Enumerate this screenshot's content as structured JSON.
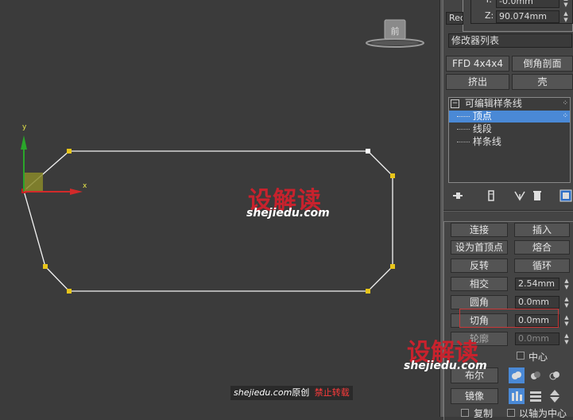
{
  "viewport": {
    "axes": {
      "x_label": "x",
      "y_label": "y"
    },
    "watermark": {
      "brand": "设解读",
      "url": "shejiedu.com"
    },
    "credit": {
      "site": "shejiedu.com",
      "original": "原创",
      "warning": "禁止转载"
    },
    "colors": {
      "background": "#3b3b3b",
      "spline": "#f4f4f4",
      "vertex": "#e8c51a",
      "selected_vertex": "#ffffff",
      "axis_x": "#d22a2a",
      "axis_y": "#2aa62a",
      "watermark_red": "#c8222d"
    }
  },
  "panel": {
    "top_coords": {
      "y_label": "Y:",
      "y_value": "-0.0mm",
      "z_label": "Z:",
      "z_value": "90.074mm"
    },
    "object_name": "Rec",
    "modifier_list": "修改器列表",
    "buttons_row1": [
      "FFD 4x4x4",
      "倒角剖面"
    ],
    "buttons_row2": [
      "挤出",
      "壳"
    ],
    "stack": {
      "root": "可编辑样条线",
      "items": [
        "顶点",
        "线段",
        "样条线"
      ]
    },
    "geometry": {
      "connect": "连接",
      "insert": "插入",
      "make_first": "设为首顶点",
      "fuse": "熔合",
      "reverse": "反转",
      "cycle": "循环",
      "cross_insert": "相交",
      "cross_insert_value": "2.54mm",
      "fillet": "圆角",
      "fillet_value": "0.0mm",
      "chamfer": "切角",
      "chamfer_value": "0.0mm",
      "outline": "轮廓",
      "outline_value": "0.0mm",
      "center": "中心",
      "boolean": "布尔",
      "mirror": "镜像",
      "copy": "复制",
      "about_pivot": "以轴为中心"
    },
    "watermark": {
      "brand": "设解读",
      "url": "shejiedu.com"
    }
  }
}
